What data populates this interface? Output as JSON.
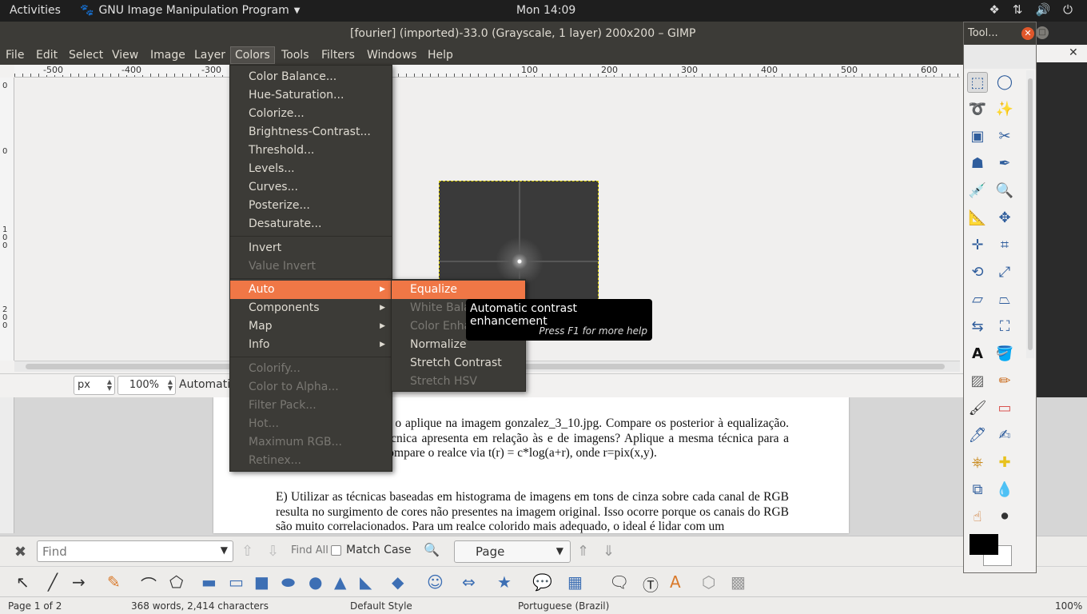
{
  "topbar": {
    "activities": "Activities",
    "app_name": "GNU Image Manipulation Program",
    "clock": "Mon 14:09"
  },
  "gimp": {
    "window_title": "[fourier] (imported)-33.0 (Grayscale, 1 layer) 200x200 – GIMP",
    "menus": [
      "File",
      "Edit",
      "Select",
      "View",
      "Image",
      "Layer",
      "Colors",
      "Tools",
      "Filters",
      "Windows",
      "Help"
    ],
    "ruler_labels": [
      "-500",
      "-400",
      "-300",
      "100",
      "200",
      "300",
      "400",
      "500",
      "600"
    ],
    "vruler_labels": [
      "0",
      "0",
      "100",
      "200"
    ],
    "status": {
      "unit": "px",
      "zoom": "100%",
      "message": "Automatic contrast enhancement"
    }
  },
  "colors_menu": {
    "items": [
      {
        "label": "Color Balance..."
      },
      {
        "label": "Hue-Saturation..."
      },
      {
        "label": "Colorize..."
      },
      {
        "label": "Brightness-Contrast..."
      },
      {
        "label": "Threshold..."
      },
      {
        "label": "Levels..."
      },
      {
        "label": "Curves..."
      },
      {
        "label": "Posterize..."
      },
      {
        "label": "Desaturate..."
      },
      {
        "label": "Invert"
      },
      {
        "label": "Value Invert"
      },
      {
        "label": "Auto"
      },
      {
        "label": "Components"
      },
      {
        "label": "Map"
      },
      {
        "label": "Info"
      },
      {
        "label": "Colorify..."
      },
      {
        "label": "Color to Alpha..."
      },
      {
        "label": "Filter Pack..."
      },
      {
        "label": "Hot..."
      },
      {
        "label": "Maximum RGB..."
      },
      {
        "label": "Retinex..."
      }
    ]
  },
  "auto_menu": {
    "items": [
      {
        "label": "Equalize"
      },
      {
        "label": "White Balance"
      },
      {
        "label": "Color Enhance"
      },
      {
        "label": "Normalize"
      },
      {
        "label": "Stretch Contrast"
      },
      {
        "label": "Stretch HSV"
      }
    ]
  },
  "tooltip": {
    "text": "Automatic contrast enhancement",
    "help": "Press F1 for more help"
  },
  "toolbox": {
    "title": "Tool..."
  },
  "writer": {
    "para1": "ização de histograma e o aplique na imagem gonzalez_3_10.jpg. Compare os posterior à equalização. Qual vantagem essa técnica apresenta em relação às e de imagens? Aplique a mesma técnica para a imagem fourier.jpg e compare o realce via t(r) = c*log(a+r), onde r=pix(x,y).",
    "para2": "E) Utilizar as técnicas baseadas em histograma de imagens em tons de cinza sobre cada canal de RGB resulta no surgimento de cores não presentes na imagem original. Isso ocorre porque os canais do RGB são muito correlacionados. Para um realce colorido mais adequado, o ideal é lidar com um",
    "find": {
      "placeholder": "Find",
      "find_all": "Find All",
      "match_case": "Match Case",
      "page_select": "Page"
    },
    "status": {
      "page": "Page 1 of 2",
      "words": "368 words, 2,414 characters",
      "style": "Default Style",
      "language": "Portuguese (Brazil)",
      "zoom": "100%"
    }
  }
}
